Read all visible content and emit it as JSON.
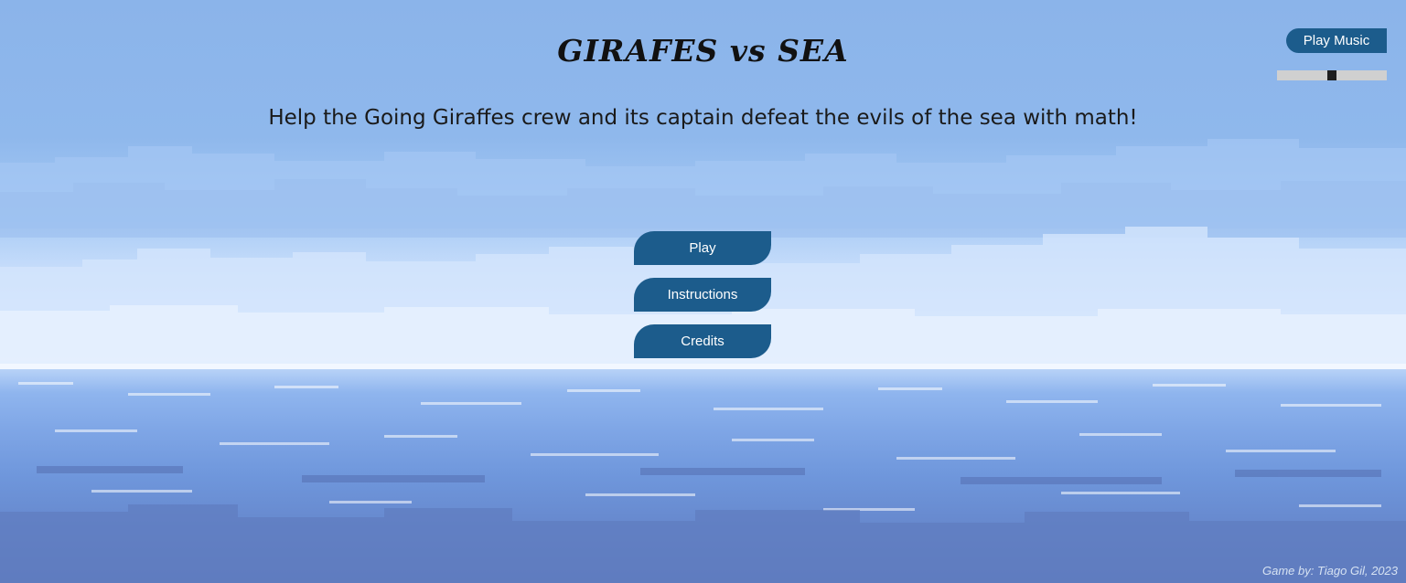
{
  "game": {
    "title": "GIRAFES vs SEA",
    "subtitle": "Help the Going Giraffes crew and its captain defeat the evils of the sea with math!"
  },
  "menu": {
    "play_label": "Play",
    "instructions_label": "Instructions",
    "credits_label": "Credits"
  },
  "music": {
    "button_label": "Play Music",
    "volume_fraction": 0.5
  },
  "footer": {
    "credit": "Game by: Tiago Gil, 2023"
  },
  "colors": {
    "button": "#1c5c8c",
    "sky": "#8bb4ea",
    "sea": "#6f97dc"
  }
}
